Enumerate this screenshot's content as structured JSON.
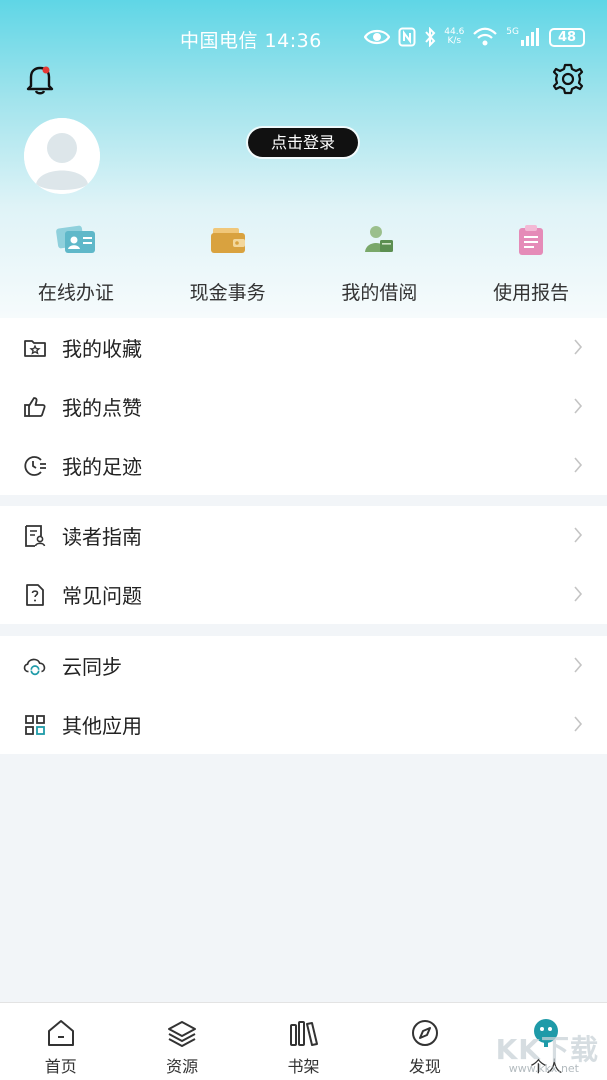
{
  "status_bar": {
    "carrier_time": "中国电信 14:36",
    "net_speed_top": "44.6",
    "net_speed_bottom": "K/s",
    "signal_label": "5G",
    "battery": "48"
  },
  "header": {
    "login_label": "点击登录"
  },
  "quick_actions": [
    {
      "label": "在线办证",
      "icon": "id-card-icon",
      "color": "#5fb8c9"
    },
    {
      "label": "现金事务",
      "icon": "wallet-icon",
      "color": "#d9a23f"
    },
    {
      "label": "我的借阅",
      "icon": "reader-icon",
      "color": "#7aa86a"
    },
    {
      "label": "使用报告",
      "icon": "clipboard-icon",
      "color": "#e58bb8"
    }
  ],
  "menu": {
    "favorites": "我的收藏",
    "likes": "我的点赞",
    "history": "我的足迹",
    "guide": "读者指南",
    "faq": "常见问题",
    "sync": "云同步",
    "other_apps": "其他应用"
  },
  "tabs": [
    {
      "label": "首页",
      "icon": "home-icon"
    },
    {
      "label": "资源",
      "icon": "layers-icon"
    },
    {
      "label": "书架",
      "icon": "bookshelf-icon"
    },
    {
      "label": "发现",
      "icon": "compass-icon"
    },
    {
      "label": "个人",
      "icon": "profile-icon",
      "active": true
    }
  ],
  "watermark": {
    "text": "KK下载",
    "url": "www.kkx.net"
  },
  "colors": {
    "accent": "#1e9aa8",
    "header_top": "#5fd6e6"
  }
}
